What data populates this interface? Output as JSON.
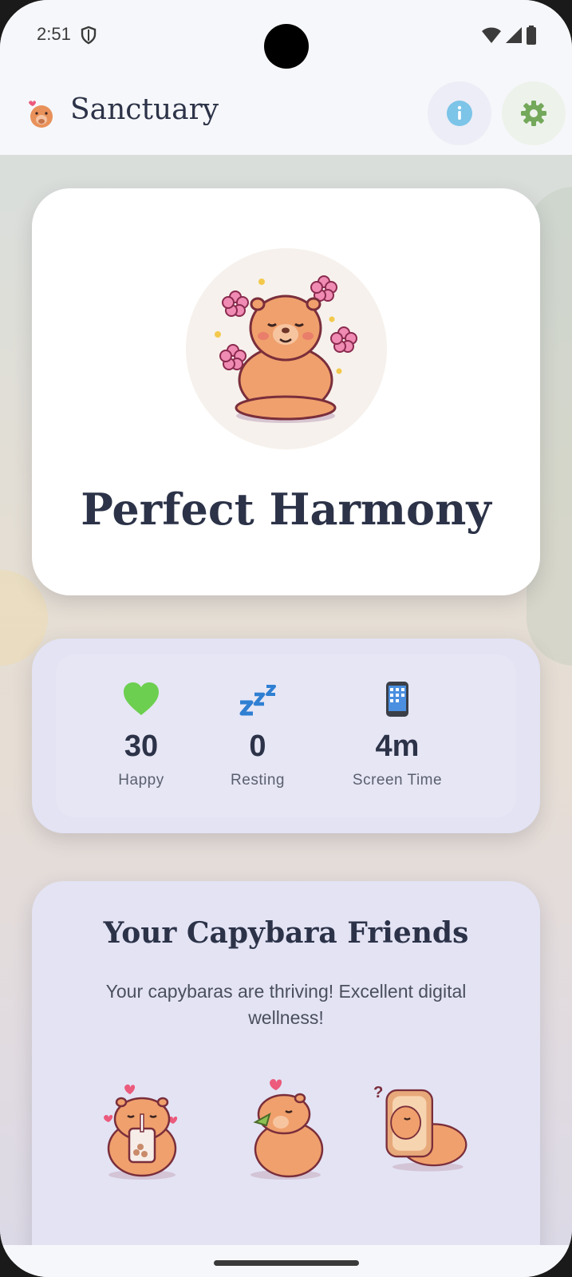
{
  "status_bar": {
    "time": "2:51"
  },
  "app_bar": {
    "title": "Sanctuary",
    "icons": {
      "logo": "capybara-logo-icon",
      "info": "info-icon",
      "settings": "gear-icon"
    },
    "colors": {
      "info": "#7cc4e8",
      "settings": "#74a85a"
    }
  },
  "hero": {
    "status_title": "Perfect Harmony",
    "illustration": "meditating-capybara-icon"
  },
  "stats": [
    {
      "icon": "green-heart-icon",
      "value": "30",
      "label": "Happy"
    },
    {
      "icon": "zzz-icon",
      "value": "0",
      "label": "Resting"
    },
    {
      "icon": "phone-icon",
      "value": "4m",
      "label": "Screen Time"
    }
  ],
  "friends": {
    "title": "Your Capybara Friends",
    "subtitle": "Your capybaras are thriving! Excellent digital wellness!",
    "items": [
      "bubble-tea-capybara-icon",
      "eating-capybara-icon",
      "toast-capybara-icon"
    ]
  }
}
